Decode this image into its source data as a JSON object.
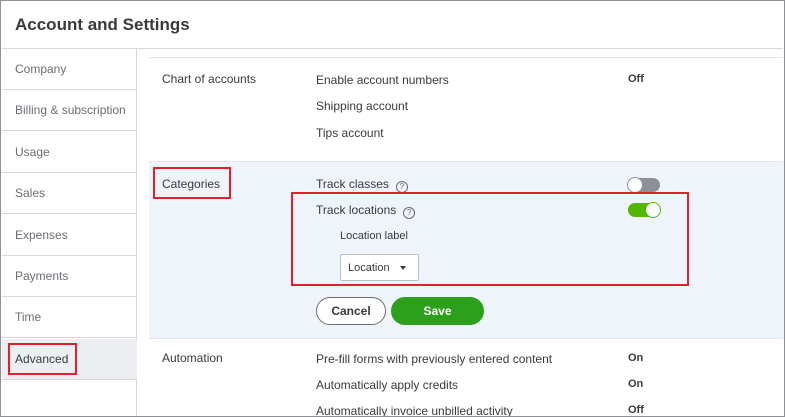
{
  "page_title": "Account and Settings",
  "sidebar": {
    "items": [
      {
        "label": "Company"
      },
      {
        "label": "Billing & subscription"
      },
      {
        "label": "Usage"
      },
      {
        "label": "Sales"
      },
      {
        "label": "Expenses"
      },
      {
        "label": "Payments"
      },
      {
        "label": "Time"
      },
      {
        "label": "Advanced",
        "active": true
      }
    ]
  },
  "sections": {
    "chart_of_accounts": {
      "label": "Chart of accounts",
      "rows": [
        {
          "label": "Enable account numbers",
          "value": "Off"
        },
        {
          "label": "Shipping account",
          "value": ""
        },
        {
          "label": "Tips account",
          "value": ""
        }
      ]
    },
    "categories": {
      "label": "Categories",
      "track_classes": {
        "label": "Track classes",
        "help": "?",
        "enabled": false
      },
      "track_locations": {
        "label": "Track locations",
        "help": "?",
        "enabled": true
      },
      "location_label": {
        "label": "Location label",
        "selected": "Location"
      },
      "cancel_label": "Cancel",
      "save_label": "Save"
    },
    "automation": {
      "label": "Automation",
      "rows": [
        {
          "label": "Pre-fill forms with previously entered content",
          "value": "On"
        },
        {
          "label": "Automatically apply credits",
          "value": "On"
        },
        {
          "label": "Automatically invoice unbilled activity",
          "value": "Off"
        }
      ]
    }
  },
  "colors": {
    "toggle_on": "#53b700",
    "toggle_off": "#8d9096",
    "save_button": "#2ca01c",
    "highlight_box": "#e0212d",
    "categories_background": "#eef4fa"
  }
}
